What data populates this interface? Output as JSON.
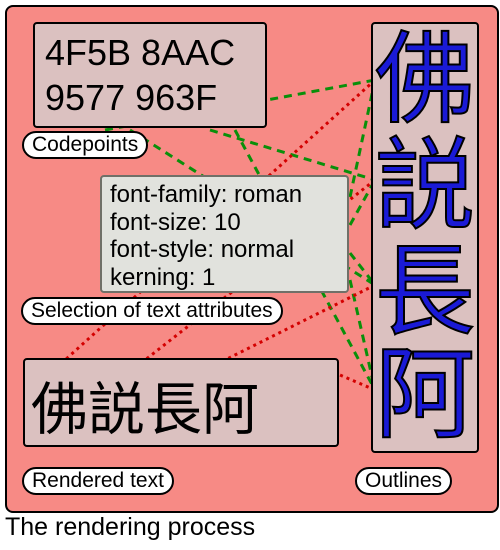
{
  "codepoints": {
    "line1": "4F5B 8AAC",
    "line2": "9577 963F"
  },
  "attributes": {
    "l1": "font-family: roman",
    "l2": "font-size: 10",
    "l3": "font-style: normal",
    "l4": "kerning: 1"
  },
  "rendered": "佛説長阿",
  "outlines": {
    "c1": "佛",
    "c2": "説",
    "c3": "長",
    "c4": "阿"
  },
  "labels": {
    "codepoints": "Codepoints",
    "attributes": "Selection of text attributes",
    "rendered": "Rendered text",
    "outlines": "Outlines"
  },
  "caption": "The rendering process"
}
